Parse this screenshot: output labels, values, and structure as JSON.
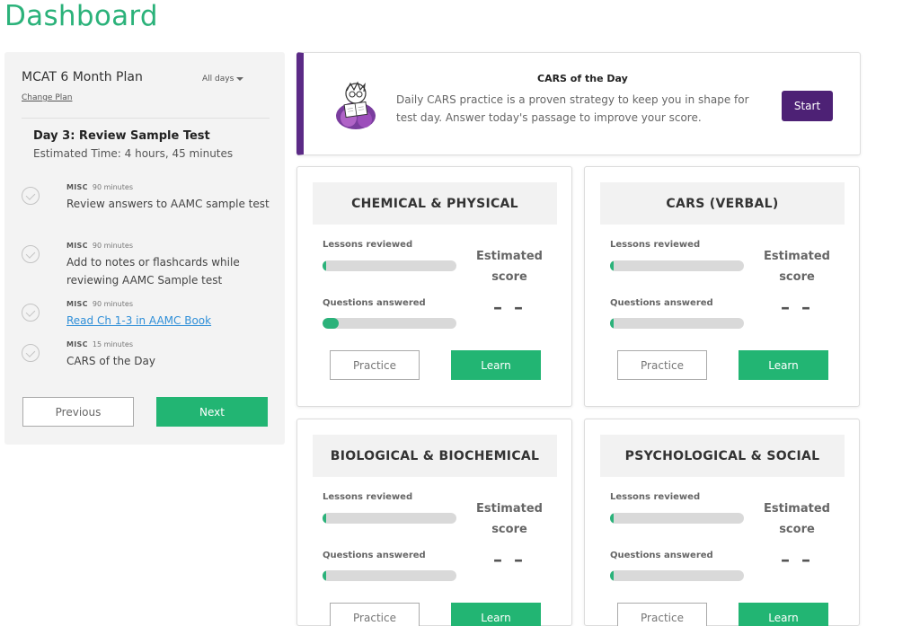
{
  "page": {
    "title": "Dashboard"
  },
  "plan": {
    "name": "MCAT 6 Month Plan",
    "change_plan": "Change Plan",
    "days_filter": "All days",
    "day_title": "Day 3: Review Sample Test",
    "estimated_time": "Estimated Time: 4 hours, 45 minutes",
    "tasks": [
      {
        "category": "MISC",
        "duration": "90 minutes",
        "name": "Review answers to AAMC sample test",
        "is_link": false
      },
      {
        "category": "MISC",
        "duration": "90 minutes",
        "name": "Add to notes or flashcards while reviewing AAMC Sample test",
        "is_link": false
      },
      {
        "category": "MISC",
        "duration": "90 minutes",
        "name": "Read Ch 1-3 in AAMC Book",
        "is_link": true
      },
      {
        "category": "MISC",
        "duration": "15 minutes",
        "name": "CARS of the Day",
        "is_link": false
      }
    ],
    "previous_label": "Previous",
    "next_label": "Next"
  },
  "cars": {
    "title": "CARS of the Day",
    "description": "Daily CARS practice is a proven strategy to keep you in shape for test day. Answer today's passage to improve your score.",
    "start_label": "Start",
    "accent_color": "#5b2a86"
  },
  "sections": [
    {
      "title": "CHEMICAL & PHYSICAL",
      "lessons_label": "Lessons reviewed",
      "lessons_progress": 0.02,
      "questions_label": "Questions answered",
      "questions_progress": 0.12,
      "estimated_label": "Estimated score",
      "score": "– –",
      "practice_label": "Practice",
      "learn_label": "Learn"
    },
    {
      "title": "CARS (VERBAL)",
      "lessons_label": "Lessons reviewed",
      "lessons_progress": 0.02,
      "questions_label": "Questions answered",
      "questions_progress": 0.02,
      "estimated_label": "Estimated score",
      "score": "– –",
      "practice_label": "Practice",
      "learn_label": "Learn"
    },
    {
      "title": "BIOLOGICAL & BIOCHEMICAL",
      "lessons_label": "Lessons reviewed",
      "lessons_progress": 0.02,
      "questions_label": "Questions answered",
      "questions_progress": 0.02,
      "estimated_label": "Estimated score",
      "score": "– –",
      "practice_label": "Practice",
      "learn_label": "Learn"
    },
    {
      "title": "PSYCHOLOGICAL & SOCIAL",
      "lessons_label": "Lessons reviewed",
      "lessons_progress": 0.02,
      "questions_label": "Questions answered",
      "questions_progress": 0.02,
      "estimated_label": "Estimated score",
      "score": "– –",
      "practice_label": "Practice",
      "learn_label": "Learn"
    }
  ],
  "colors": {
    "brand_green": "#2bb27a",
    "button_green": "#22b573",
    "start_purple": "#4d2175"
  }
}
